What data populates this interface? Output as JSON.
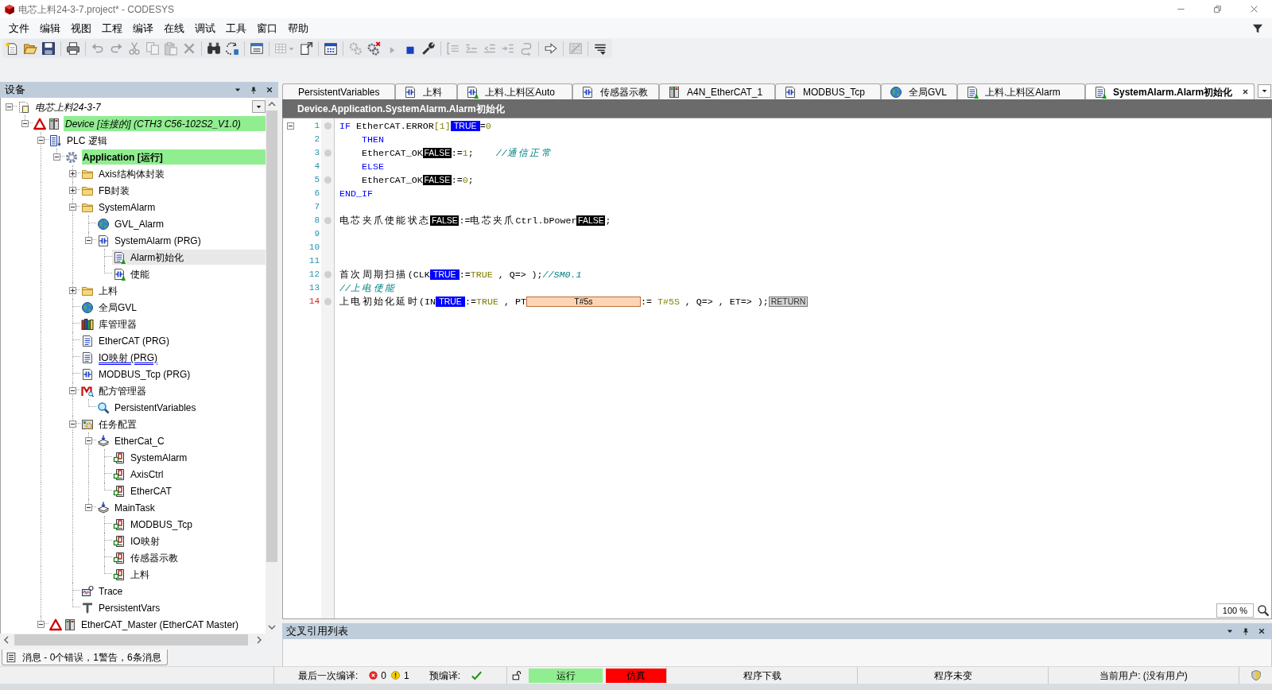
{
  "window": {
    "title": "电芯上料24-3-7.project* - CODESYS"
  },
  "menu": [
    "文件",
    "编辑",
    "视图",
    "工程",
    "编译",
    "在线",
    "调试",
    "工具",
    "窗口",
    "帮助"
  ],
  "toolbar": [
    {
      "kind": "new-file",
      "disabled": false
    },
    {
      "kind": "open",
      "disabled": false
    },
    {
      "kind": "save",
      "disabled": false
    },
    {
      "kind": "separator"
    },
    {
      "kind": "print",
      "disabled": false
    },
    {
      "kind": "separator"
    },
    {
      "kind": "undo",
      "disabled": true
    },
    {
      "kind": "redo",
      "disabled": true
    },
    {
      "kind": "cut",
      "disabled": true
    },
    {
      "kind": "copy",
      "disabled": true
    },
    {
      "kind": "paste",
      "disabled": true
    },
    {
      "kind": "delete",
      "disabled": true
    },
    {
      "kind": "separator"
    },
    {
      "kind": "find",
      "disabled": false
    },
    {
      "kind": "replace",
      "disabled": false
    },
    {
      "kind": "separator"
    },
    {
      "kind": "window",
      "disabled": false
    },
    {
      "kind": "separator"
    },
    {
      "kind": "table",
      "disabled": true
    },
    {
      "kind": "export",
      "disabled": false
    },
    {
      "kind": "separator"
    },
    {
      "kind": "build",
      "disabled": false
    },
    {
      "kind": "separator"
    },
    {
      "kind": "login",
      "disabled": true
    },
    {
      "kind": "logout",
      "disabled": false
    },
    {
      "kind": "start",
      "disabled": true
    },
    {
      "kind": "stop",
      "disabled": false
    },
    {
      "kind": "reset",
      "disabled": false
    },
    {
      "kind": "separator"
    },
    {
      "kind": "step-over",
      "disabled": true
    },
    {
      "kind": "step-into",
      "disabled": true
    },
    {
      "kind": "step-out",
      "disabled": true
    },
    {
      "kind": "run-to-cursor",
      "disabled": true
    },
    {
      "kind": "set-next",
      "disabled": true
    },
    {
      "kind": "separator"
    },
    {
      "kind": "show-next",
      "disabled": false
    },
    {
      "kind": "separator"
    },
    {
      "kind": "breakpoints",
      "disabled": true
    },
    {
      "kind": "separator"
    },
    {
      "kind": "customize",
      "disabled": false
    }
  ],
  "devices_panel": {
    "title": "设备",
    "tree": [
      {
        "label": "电芯上料24-3-7",
        "kind": "project",
        "selected": false,
        "expanded": true,
        "children": [
          {
            "label": "Device [连接的] (CTH3 C56-102S2_V1.0)",
            "kind": "device",
            "selected": false,
            "warning": true,
            "online": true,
            "expanded": true,
            "children": [
              {
                "label": "PLC 逻辑",
                "kind": "plc-logic",
                "selected": false,
                "expanded": true,
                "children": [
                  {
                    "label": "Application [运行]",
                    "kind": "application",
                    "selected": false,
                    "online": true,
                    "expanded": true,
                    "children": [
                      {
                        "label": "Axis结构体封装",
                        "kind": "folder",
                        "selected": false,
                        "expanded": false
                      },
                      {
                        "label": "FB封装",
                        "kind": "folder",
                        "selected": false,
                        "expanded": false
                      },
                      {
                        "label": "SystemAlarm",
                        "kind": "folder",
                        "selected": false,
                        "expanded": true,
                        "children": [
                          {
                            "label": "GVL_Alarm",
                            "kind": "gvl",
                            "selected": false
                          },
                          {
                            "label": "SystemAlarm (PRG)",
                            "kind": "program-ld",
                            "selected": false,
                            "marked": false,
                            "expanded": true,
                            "children": [
                              {
                                "label": "Alarm初始化",
                                "kind": "action-st",
                                "selected": true
                              },
                              {
                                "label": "使能",
                                "kind": "action-ld",
                                "selected": false
                              }
                            ]
                          }
                        ]
                      },
                      {
                        "label": "上料",
                        "kind": "folder",
                        "selected": false,
                        "expanded": false
                      },
                      {
                        "label": "全局GVL",
                        "kind": "gvl",
                        "selected": false
                      },
                      {
                        "label": "库管理器",
                        "kind": "library",
                        "selected": false
                      },
                      {
                        "label": "EtherCAT (PRG)",
                        "kind": "program-st",
                        "selected": false,
                        "marked": false
                      },
                      {
                        "label": "IO映射 (PRG)",
                        "kind": "program-st",
                        "selected": false,
                        "marked": true
                      },
                      {
                        "label": "MODBUS_Tcp (PRG)",
                        "kind": "program-ld",
                        "selected": false,
                        "marked": false
                      },
                      {
                        "label": "配方管理器",
                        "kind": "recipe",
                        "selected": false,
                        "expanded": true,
                        "children": [
                          {
                            "label": "PersistentVariables",
                            "kind": "recipe-definition",
                            "selected": false
                          }
                        ]
                      },
                      {
                        "label": "任务配置",
                        "kind": "task-config",
                        "selected": false,
                        "expanded": true,
                        "children": [
                          {
                            "label": "EtherCat_C",
                            "kind": "task",
                            "selected": false,
                            "expanded": true,
                            "children": [
                              {
                                "label": "SystemAlarm",
                                "kind": "task-call",
                                "selected": false
                              },
                              {
                                "label": "AxisCtrl",
                                "kind": "task-call",
                                "selected": false
                              },
                              {
                                "label": "EtherCAT",
                                "kind": "task-call",
                                "selected": false
                              }
                            ]
                          },
                          {
                            "label": "MainTask",
                            "kind": "task",
                            "selected": false,
                            "expanded": true,
                            "children": [
                              {
                                "label": "MODBUS_Tcp",
                                "kind": "task-call",
                                "selected": false
                              },
                              {
                                "label": "IO映射",
                                "kind": "task-call",
                                "selected": false
                              },
                              {
                                "label": "传感器示教",
                                "kind": "task-call",
                                "selected": false
                              },
                              {
                                "label": "上料",
                                "kind": "task-call",
                                "selected": false
                              }
                            ]
                          }
                        ]
                      },
                      {
                        "label": "Trace",
                        "kind": "trace",
                        "selected": false
                      },
                      {
                        "label": "PersistentVars",
                        "kind": "persistent-vars",
                        "selected": false
                      }
                    ]
                  }
                ]
              },
              {
                "label": "EtherCAT_Master (EtherCAT Master)",
                "kind": "device",
                "selected": false,
                "warning": true,
                "online": false,
                "expanded": true
              }
            ]
          }
        ]
      }
    ]
  },
  "messages_tab": {
    "label": "消息 - 0个错误，1警告，6条消息"
  },
  "editor_tabs": [
    {
      "label": "PersistentVariables",
      "selected": false
    },
    {
      "label": "上料",
      "kind": "program-ld",
      "selected": false
    },
    {
      "label": "上料.上料区Auto",
      "kind": "action-ld",
      "selected": false
    },
    {
      "label": "传感器示教",
      "kind": "program-ld",
      "selected": false
    },
    {
      "label": "A4N_EtherCAT_1",
      "kind": "device",
      "selected": false
    },
    {
      "label": "MODBUS_Tcp",
      "kind": "program-ld",
      "selected": false
    },
    {
      "label": "全局GVL",
      "kind": "gvl",
      "selected": false
    },
    {
      "label": "上料.上料区Alarm",
      "kind": "action-st",
      "selected": false
    },
    {
      "label": "SystemAlarm.Alarm初始化",
      "kind": "action-st",
      "selected": true
    }
  ],
  "editor": {
    "path": "Device.Application.SystemAlarm.Alarm初始化",
    "zoom": "100 %",
    "lines": [
      {
        "number": "1",
        "expanded": true,
        "marker": true,
        "current": false,
        "indented": false,
        "tokens": [
          {
            "kind": "keyword",
            "text": "IF"
          },
          {
            "kind": "text",
            "text": " EtherCAT.ERROR"
          },
          {
            "kind": "literal",
            "text": "[1]"
          },
          {
            "kind": "watch-true",
            "text": "TRUE"
          },
          {
            "kind": "text",
            "text": "="
          },
          {
            "kind": "literal",
            "text": "0"
          }
        ]
      },
      {
        "number": "2",
        "marker": false,
        "current": false,
        "indented": true,
        "tokens": [
          {
            "kind": "keyword",
            "text": "THEN"
          }
        ]
      },
      {
        "number": "3",
        "marker": true,
        "current": false,
        "indented": true,
        "tokens": [
          {
            "kind": "text",
            "text": "EtherCAT_OK"
          },
          {
            "kind": "watch-false",
            "text": "FALSE"
          },
          {
            "kind": "text",
            "text": ":="
          },
          {
            "kind": "literal",
            "text": "1"
          },
          {
            "kind": "text",
            "text": ";    "
          },
          {
            "kind": "comment",
            "text": "//通信正常"
          }
        ]
      },
      {
        "number": "4",
        "marker": false,
        "current": false,
        "indented": true,
        "tokens": [
          {
            "kind": "keyword",
            "text": "ELSE"
          }
        ]
      },
      {
        "number": "5",
        "marker": true,
        "current": false,
        "indented": true,
        "tokens": [
          {
            "kind": "text",
            "text": "EtherCAT_OK"
          },
          {
            "kind": "watch-false",
            "text": "FALSE"
          },
          {
            "kind": "text",
            "text": ":="
          },
          {
            "kind": "literal",
            "text": "0"
          },
          {
            "kind": "text",
            "text": ";"
          }
        ]
      },
      {
        "number": "6",
        "marker": false,
        "current": false,
        "indented": false,
        "tokens": [
          {
            "kind": "keyword",
            "text": "END_IF"
          }
        ]
      },
      {
        "number": "7",
        "marker": false,
        "current": false,
        "indented": false
      },
      {
        "number": "8",
        "marker": true,
        "current": false,
        "indented": false,
        "tokens": [
          {
            "kind": "text",
            "text": "电芯夹爪使能状态"
          },
          {
            "kind": "watch-false",
            "text": "FALSE"
          },
          {
            "kind": "text",
            "text": ":=电芯夹爪Ctrl.bPower"
          },
          {
            "kind": "watch-false",
            "text": "FALSE"
          },
          {
            "kind": "text",
            "text": ";"
          }
        ]
      },
      {
        "number": "9",
        "marker": false,
        "current": false,
        "indented": false
      },
      {
        "number": "10",
        "marker": false,
        "current": false,
        "indented": false
      },
      {
        "number": "11",
        "marker": false,
        "current": false,
        "indented": false
      },
      {
        "number": "12",
        "marker": true,
        "current": false,
        "indented": false,
        "tokens": [
          {
            "kind": "text",
            "text": "首次周期扫描(CLK"
          },
          {
            "kind": "watch-true",
            "text": "TRUE"
          },
          {
            "kind": "text",
            "text": ":="
          },
          {
            "kind": "literal",
            "text": "TRUE"
          },
          {
            "kind": "text",
            "text": " , Q=> );"
          },
          {
            "kind": "comment",
            "text": "//SM0.1"
          }
        ]
      },
      {
        "number": "13",
        "marker": false,
        "current": false,
        "indented": false,
        "tokens": [
          {
            "kind": "comment",
            "text": "//上电使能"
          }
        ]
      },
      {
        "number": "14",
        "marker": true,
        "current": true,
        "indented": false,
        "tokens": [
          {
            "kind": "text",
            "text": "上电初始化延时(IN"
          },
          {
            "kind": "watch-true",
            "text": "TRUE"
          },
          {
            "kind": "text",
            "text": ":="
          },
          {
            "kind": "literal",
            "text": "TRUE"
          },
          {
            "kind": "text",
            "text": " , PT"
          },
          {
            "kind": "watch-time",
            "text": "T#5s"
          },
          {
            "kind": "text",
            "text": ":= "
          },
          {
            "kind": "literal",
            "text": "T#5S"
          },
          {
            "kind": "text",
            "text": " , Q=> , ET=> );"
          },
          {
            "kind": "return",
            "text": "RETURN"
          }
        ]
      }
    ]
  },
  "cross_reference_panel": {
    "title": "交叉引用列表"
  },
  "status_bar": {
    "last_build_label": "最后一次编译:",
    "errors": "0",
    "warnings": "1",
    "precompile_label": "预编译:",
    "fields": [
      {
        "text": "运行",
        "color": "#90ee90"
      },
      {
        "text": "仿真",
        "color": "#ff0000"
      },
      {
        "text": "程序下载"
      },
      {
        "text": "程序未变"
      },
      {
        "text": "当前用户: (没有用户)"
      }
    ]
  }
}
